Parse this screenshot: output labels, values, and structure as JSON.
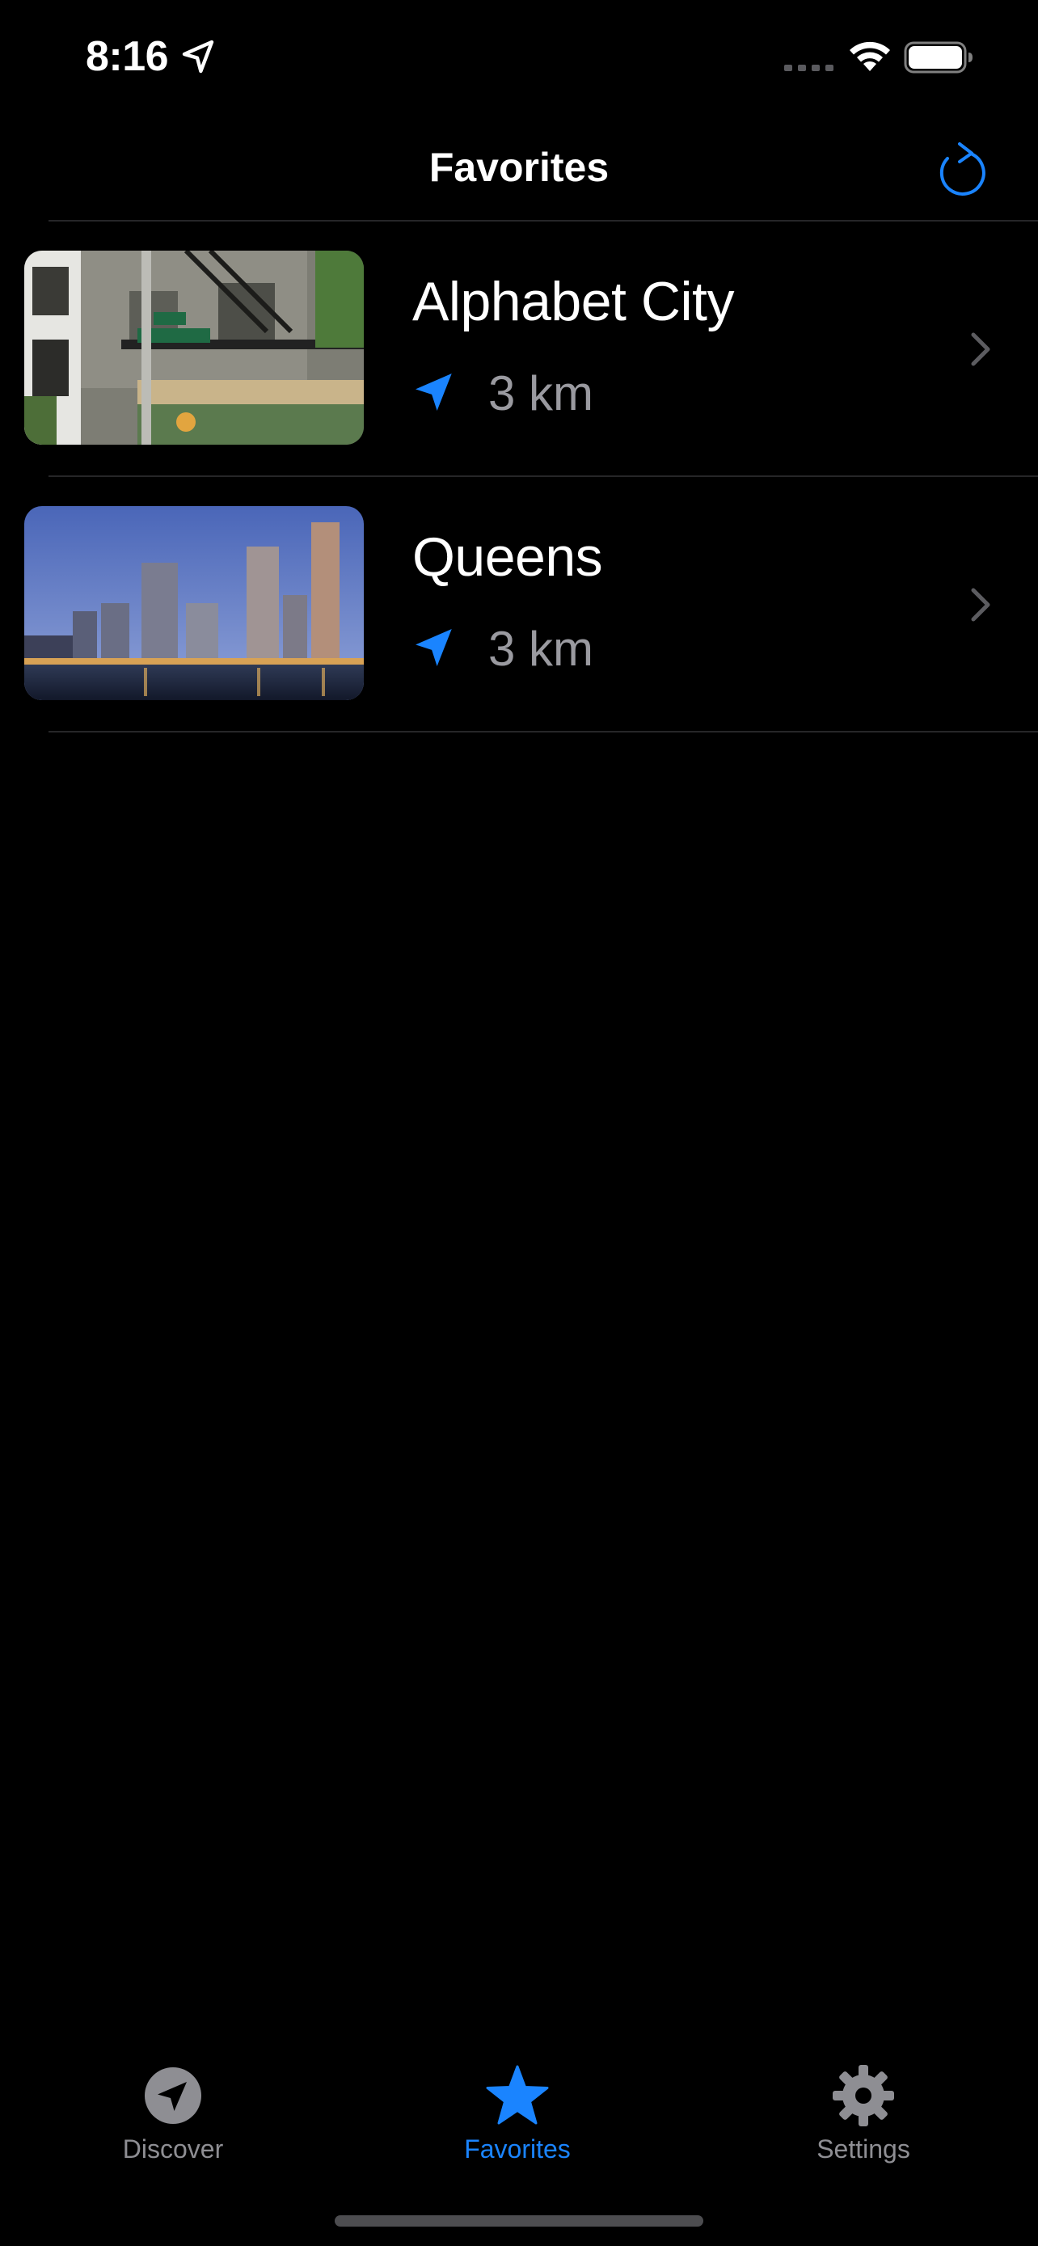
{
  "status_bar": {
    "time": "8:16",
    "location_icon": "location-arrow-icon",
    "signal_icon": "signal-dots-icon",
    "wifi_icon": "wifi-icon",
    "battery_icon": "battery-icon"
  },
  "nav": {
    "title": "Favorites",
    "refresh_icon": "refresh-icon"
  },
  "favorites": [
    {
      "name": "Alphabet City",
      "distance": "3 km",
      "image": "street-corner-photo",
      "distance_icon": "location-arrow-icon",
      "chevron_icon": "chevron-right-icon"
    },
    {
      "name": "Queens",
      "distance": "3 km",
      "image": "skyline-photo",
      "distance_icon": "location-arrow-icon",
      "chevron_icon": "chevron-right-icon"
    }
  ],
  "tab_bar": {
    "tabs": [
      {
        "label": "Discover",
        "icon": "compass-arrow-icon",
        "selected": false
      },
      {
        "label": "Favorites",
        "icon": "star-icon",
        "selected": true
      },
      {
        "label": "Settings",
        "icon": "gear-icon",
        "selected": false
      }
    ]
  },
  "colors": {
    "background": "#000000",
    "accent": "#1a84ff",
    "secondary_text": "#9a9aa0",
    "inactive_tab": "#8e8e93",
    "separator": "#262628"
  }
}
